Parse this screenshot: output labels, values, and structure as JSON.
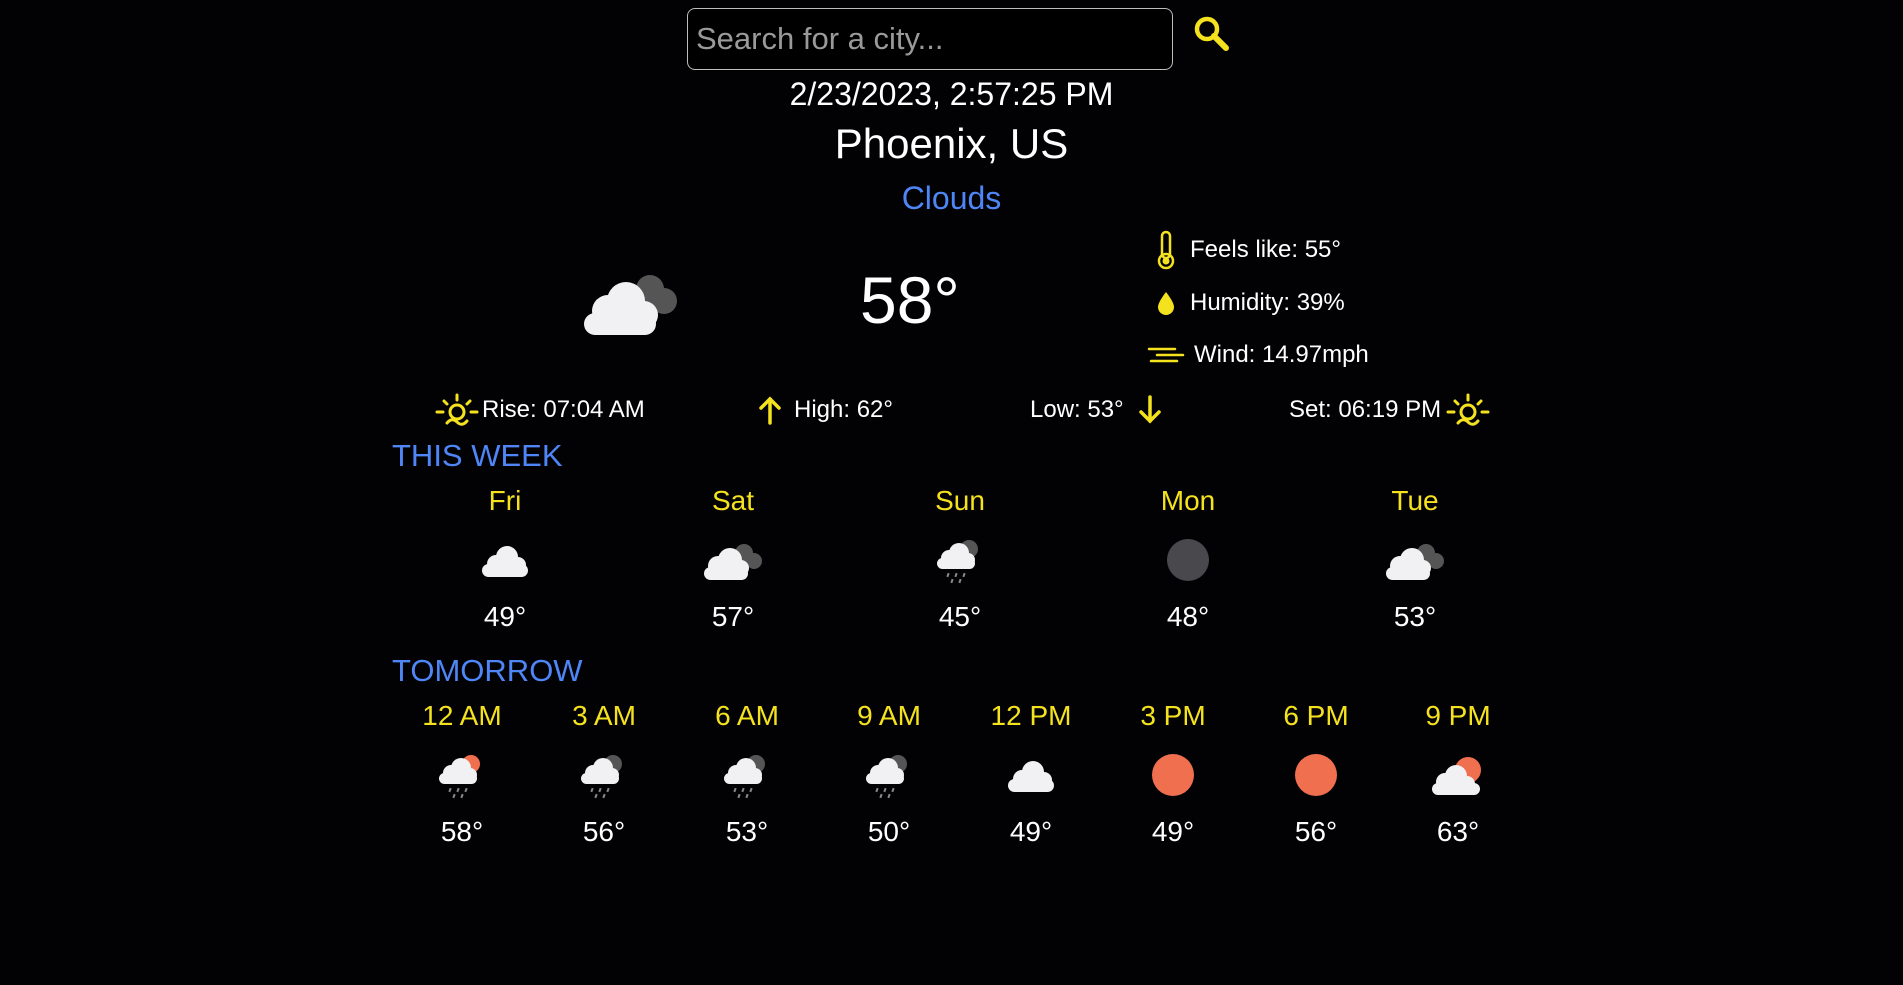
{
  "search": {
    "placeholder": "Search for a city..."
  },
  "current": {
    "datetime": "2/23/2023, 2:57:25 PM",
    "location": "Phoenix, US",
    "condition": "Clouds",
    "temp": "58°",
    "icon": "cloudy-icon",
    "feels_like": "Feels like: 55°",
    "humidity": "Humidity: 39%",
    "wind": "Wind: 14.97mph",
    "sunrise": "Rise: 07:04 AM",
    "high": "High: 62°",
    "low": "Low: 53°",
    "sunset": "Set: 06:19 PM"
  },
  "week": {
    "title": "THIS WEEK",
    "days": [
      {
        "label": "Fri",
        "icon": "cloud-icon",
        "temp": "49°"
      },
      {
        "label": "Sat",
        "icon": "cloudy-icon",
        "temp": "57°"
      },
      {
        "label": "Sun",
        "icon": "rain-cloud-icon",
        "temp": "45°"
      },
      {
        "label": "Mon",
        "icon": "overcast-icon",
        "temp": "48°"
      },
      {
        "label": "Tue",
        "icon": "cloudy-icon",
        "temp": "53°"
      }
    ]
  },
  "tomorrow": {
    "title": "TOMORROW",
    "hours": [
      {
        "label": "12 AM",
        "icon": "rain-sun-cloud-icon",
        "temp": "58°"
      },
      {
        "label": "3 AM",
        "icon": "rain-cloud-icon",
        "temp": "56°"
      },
      {
        "label": "6 AM",
        "icon": "rain-cloud-icon",
        "temp": "53°"
      },
      {
        "label": "9 AM",
        "icon": "rain-cloud-icon",
        "temp": "50°"
      },
      {
        "label": "12 PM",
        "icon": "cloud-icon",
        "temp": "49°"
      },
      {
        "label": "3 PM",
        "icon": "sun-icon",
        "temp": "49°"
      },
      {
        "label": "6 PM",
        "icon": "sun-icon",
        "temp": "56°"
      },
      {
        "label": "9 PM",
        "icon": "sun-cloud-icon",
        "temp": "63°"
      }
    ]
  },
  "colors": {
    "accent": "#f5e21e",
    "section": "#4f86f7",
    "sun": "#ef6f4f",
    "background": "#020205"
  }
}
